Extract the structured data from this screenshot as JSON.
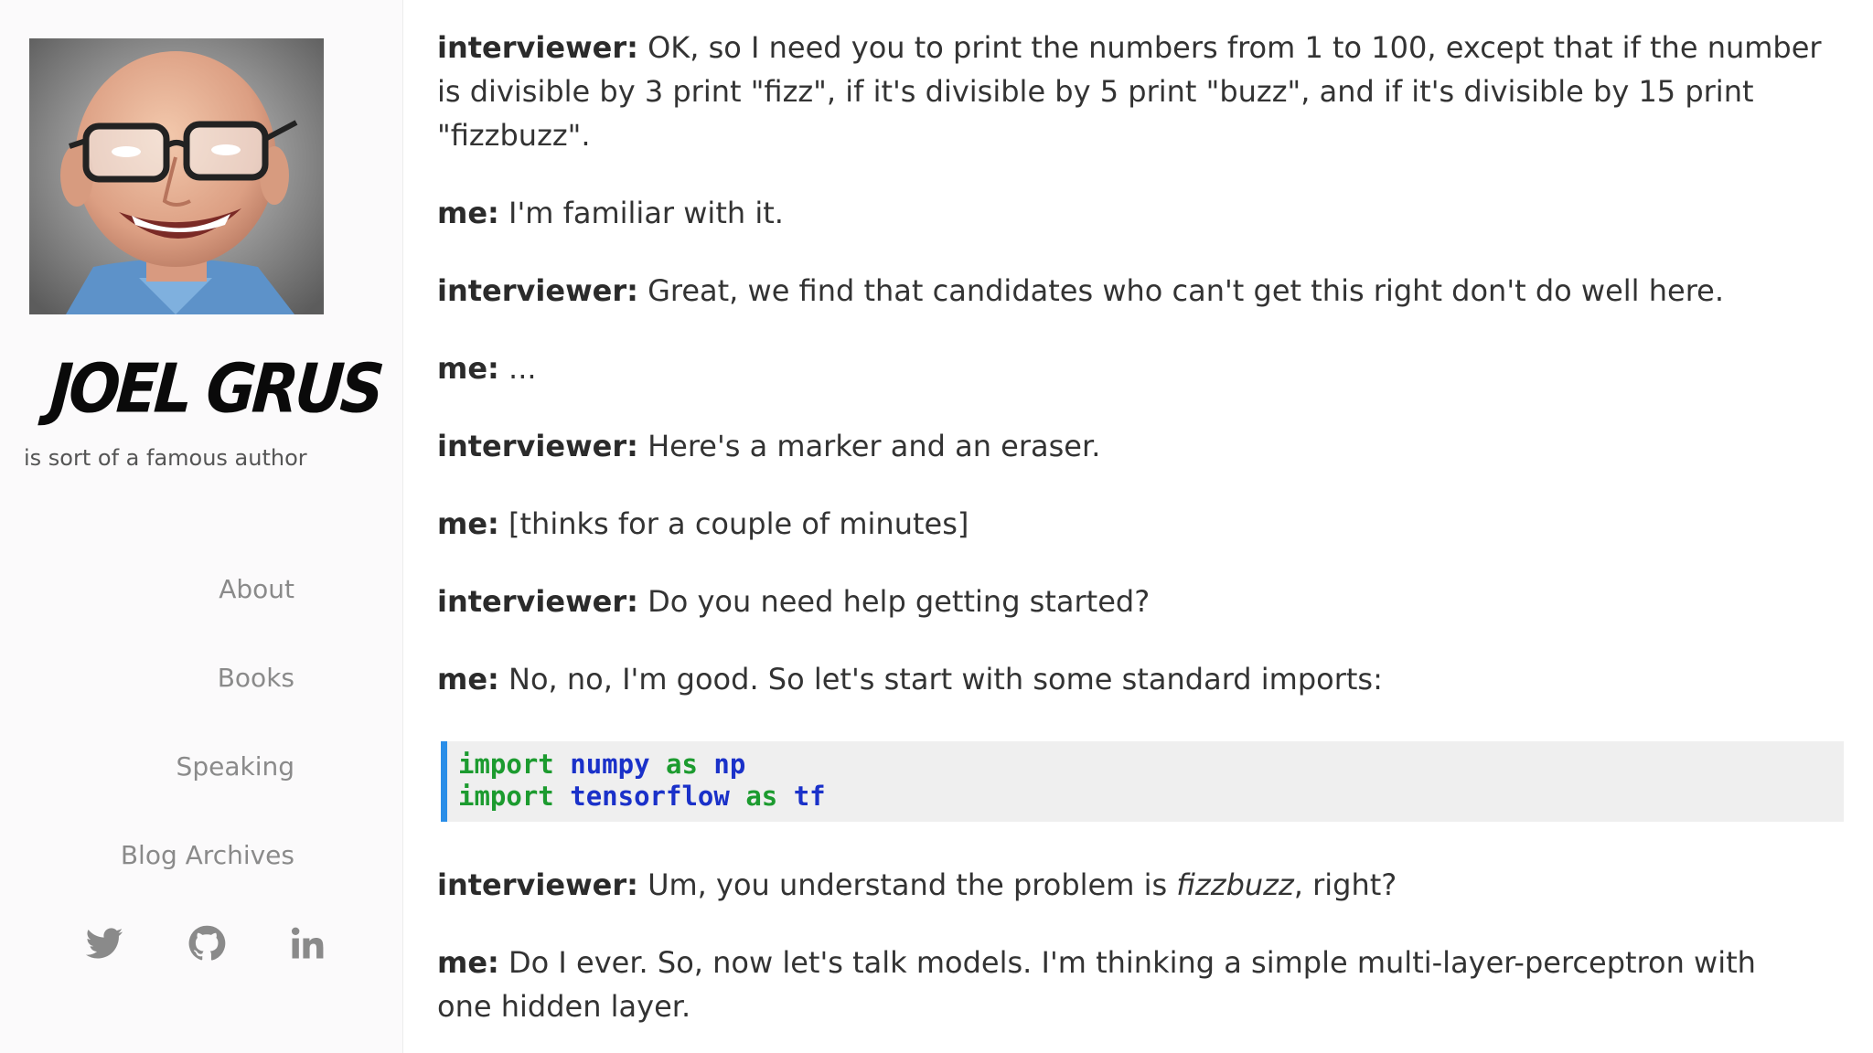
{
  "sidebar": {
    "author_name": "JOEL GRUS",
    "tagline": "is sort of a famous author",
    "nav": [
      {
        "label": "About"
      },
      {
        "label": "Books"
      },
      {
        "label": "Speaking"
      },
      {
        "label": "Blog Archives"
      }
    ],
    "social_icons": [
      "twitter-icon",
      "github-icon",
      "linkedin-icon"
    ]
  },
  "dialogue": [
    {
      "speaker": "interviewer:",
      "lines": [
        "OK, so I need you to print the numbers from 1 to 100, except that if the number",
        "is divisible by 3 print \"fizz\", if it's divisible by 5 print \"buzz\", and if it's divisible by 15 print",
        "\"fizzbuzz\"."
      ]
    },
    {
      "speaker": "me:",
      "lines": [
        "I'm familiar with it."
      ]
    },
    {
      "speaker": "interviewer:",
      "lines": [
        "Great, we find that candidates who can't get this right don't do well here."
      ]
    },
    {
      "speaker": "me:",
      "lines": [
        "..."
      ]
    },
    {
      "speaker": "interviewer:",
      "lines": [
        "Here's a marker and an eraser."
      ]
    },
    {
      "speaker": "me:",
      "lines": [
        "[thinks for a couple of minutes]"
      ]
    },
    {
      "speaker": "interviewer:",
      "lines": [
        "Do you need help getting started?"
      ]
    },
    {
      "speaker": "me:",
      "lines": [
        "No, no, I'm good. So let's start with some standard imports:"
      ]
    },
    {
      "speaker": "interviewer:",
      "lines_before_italic": "Um, you understand the problem is ",
      "italic": "fizzbuzz",
      "lines_after_italic": ", right?"
    },
    {
      "speaker": "me:",
      "lines": [
        "Do I ever. So, now let's talk models. I'm thinking a simple multi-layer-perceptron with",
        "one hidden layer."
      ]
    }
  ],
  "code": {
    "line1": {
      "kw1": "import",
      "mod": "numpy",
      "kw2": "as",
      "alias": "np"
    },
    "line2": {
      "kw1": "import",
      "mod": "tensorflow",
      "kw2": "as",
      "alias": "tf"
    }
  },
  "colors": {
    "code_keyword": "#1c9b2f",
    "code_name": "#1a31c9",
    "code_border": "#2a8ee8",
    "sidebar_bg": "#fbfafb",
    "nav_text": "#8a8a8a"
  }
}
